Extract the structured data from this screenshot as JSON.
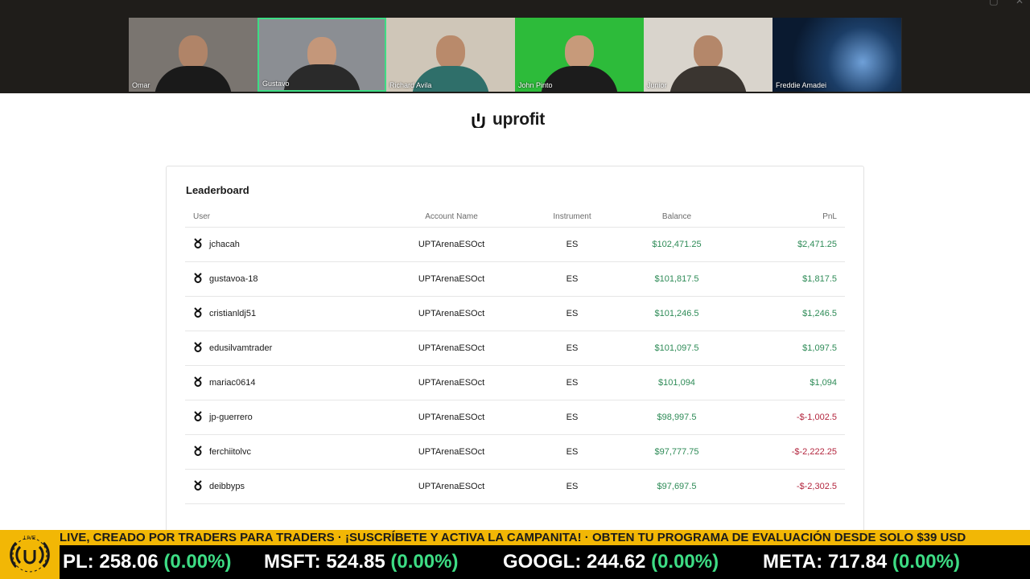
{
  "participants": [
    {
      "name": "Omar",
      "bg": "#7a7570",
      "skin": "#b08468",
      "shirt": "#1a1a1a"
    },
    {
      "name": "Gustavo",
      "bg": "#8b8e93",
      "skin": "#c4977a",
      "shirt": "#2a2a2a",
      "active": true
    },
    {
      "name": "Richard Avila",
      "bg": "#cfc6b8",
      "skin": "#b98a6b",
      "shirt": "#2f6f6a"
    },
    {
      "name": "John Pinto",
      "bg": "#2dbb3a",
      "skin": "#c79a7a",
      "shirt": "#1c1c1c"
    },
    {
      "name": "Junior",
      "bg": "#d9d4cc",
      "skin": "#b4876a",
      "shirt": "#3a3530"
    },
    {
      "name": "Freddie Amadei",
      "bg": "#0e2a4a",
      "skin": "#0e2a4a",
      "shirt": "#0e2a4a"
    }
  ],
  "window_controls": {
    "minimize": "▢",
    "close": "✕"
  },
  "brand": {
    "name": "uprofit"
  },
  "leaderboard": {
    "title": "Leaderboard",
    "columns": {
      "user": "User",
      "account": "Account Name",
      "instrument": "Instrument",
      "balance": "Balance",
      "pnl": "PnL"
    },
    "rows": [
      {
        "user": "jchacah",
        "account": "UPTArenaESOct",
        "instrument": "ES",
        "balance": "$102,471.25",
        "pnl": "$2,471.25",
        "positive": true
      },
      {
        "user": "gustavoa-18",
        "account": "UPTArenaESOct",
        "instrument": "ES",
        "balance": "$101,817.5",
        "pnl": "$1,817.5",
        "positive": true
      },
      {
        "user": "cristianldj51",
        "account": "UPTArenaESOct",
        "instrument": "ES",
        "balance": "$101,246.5",
        "pnl": "$1,246.5",
        "positive": true
      },
      {
        "user": "edusilvamtrader",
        "account": "UPTArenaESOct",
        "instrument": "ES",
        "balance": "$101,097.5",
        "pnl": "$1,097.5",
        "positive": true
      },
      {
        "user": "mariac0614",
        "account": "UPTArenaESOct",
        "instrument": "ES",
        "balance": "$101,094",
        "pnl": "$1,094",
        "positive": true
      },
      {
        "user": "jp-guerrero",
        "account": "UPTArenaESOct",
        "instrument": "ES",
        "balance": "$98,997.5",
        "pnl": "-$-1,002.5",
        "positive": false
      },
      {
        "user": "ferchiitolvc",
        "account": "UPTArenaESOct",
        "instrument": "ES",
        "balance": "$97,777.75",
        "pnl": "-$-2,222.25",
        "positive": false
      },
      {
        "user": "deibbyps",
        "account": "UPTArenaESOct",
        "instrument": "ES",
        "balance": "$97,697.5",
        "pnl": "-$-2,302.5",
        "positive": false
      }
    ]
  },
  "ticker": {
    "banner": "LIVE, CREADO POR TRADERS PARA TRADERS  ·  ¡SUSCRÍBETE Y ACTIVA LA CAMPANITA!  ·  OBTEN TU PROGRAMA DE EVALUACIÓN DESDE SOLO $39 USD",
    "stocks": [
      {
        "symbol": "PL:",
        "price": "258.06",
        "change": "(0.00%)"
      },
      {
        "symbol": "MSFT:",
        "price": "524.85",
        "change": "(0.00%)"
      },
      {
        "symbol": "GOOGL:",
        "price": "244.62",
        "change": "(0.00%)"
      },
      {
        "symbol": "META:",
        "price": "717.84",
        "change": "(0.00%)"
      }
    ],
    "badge_label": "LIVE"
  },
  "colors": {
    "positive": "#2e8b57",
    "negative": "#b3263e",
    "ticker_yellow": "#f2b705",
    "active_tile": "#3ddc84"
  }
}
